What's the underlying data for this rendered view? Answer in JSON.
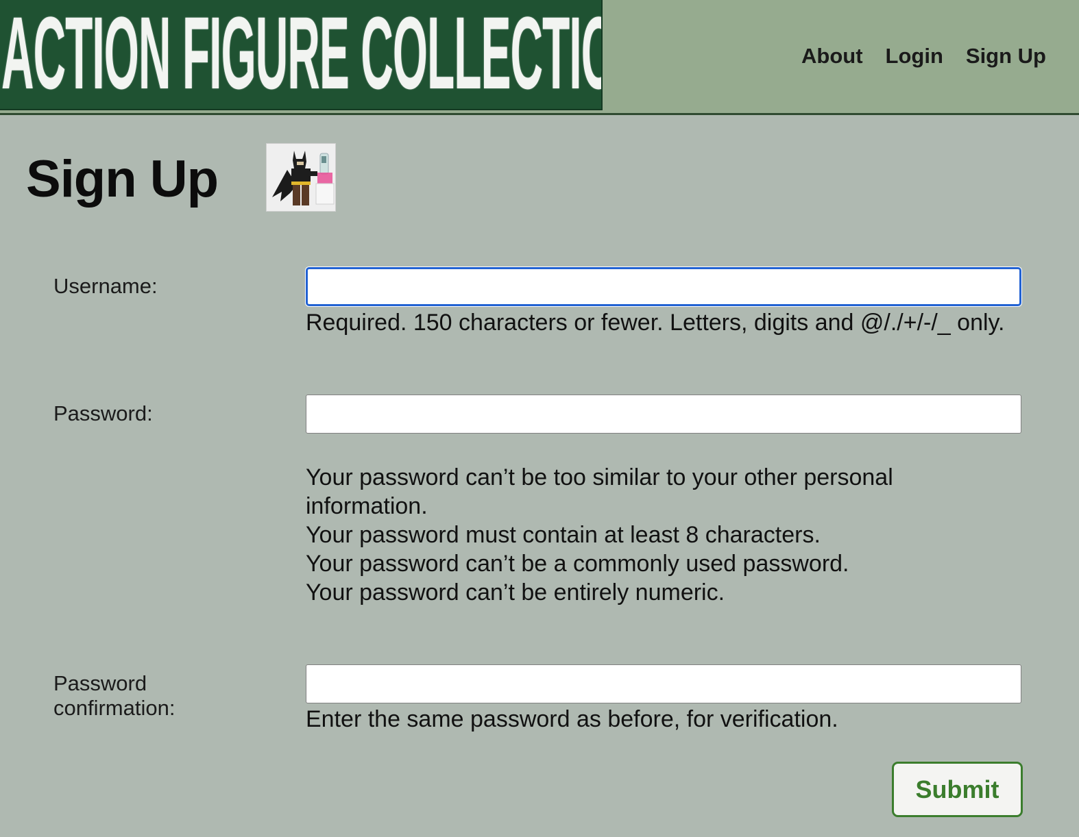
{
  "header": {
    "logo_text": "ACTION FIGURE COLLECTION",
    "nav": [
      {
        "label": "About"
      },
      {
        "label": "Login"
      },
      {
        "label": "Sign Up"
      }
    ]
  },
  "page": {
    "title": "Sign Up"
  },
  "form": {
    "username": {
      "label": "Username:",
      "value": "",
      "help": " Required. 150 characters or fewer. Letters, digits and @/./+/-/_ only."
    },
    "password": {
      "label": "Password:",
      "value": "",
      "help": [
        "Your password can’t be too similar to your other personal information.",
        "Your password must contain at least 8 characters.",
        "Your password can’t be a commonly used password.",
        "Your password can’t be entirely numeric."
      ]
    },
    "password_confirmation": {
      "label_line1": "Password",
      "label_line2": "confirmation:",
      "value": "",
      "help": " Enter the same password as before, for verification."
    },
    "submit_label": "Submit"
  },
  "colors": {
    "header_bg": "#96ab8f",
    "logo_bg": "#1f5232",
    "page_bg": "#afb9b1",
    "focus_border": "#2262d3",
    "submit_accent": "#3b7d2d"
  },
  "icons": {
    "avatar": "lego-batman-figure-image"
  }
}
